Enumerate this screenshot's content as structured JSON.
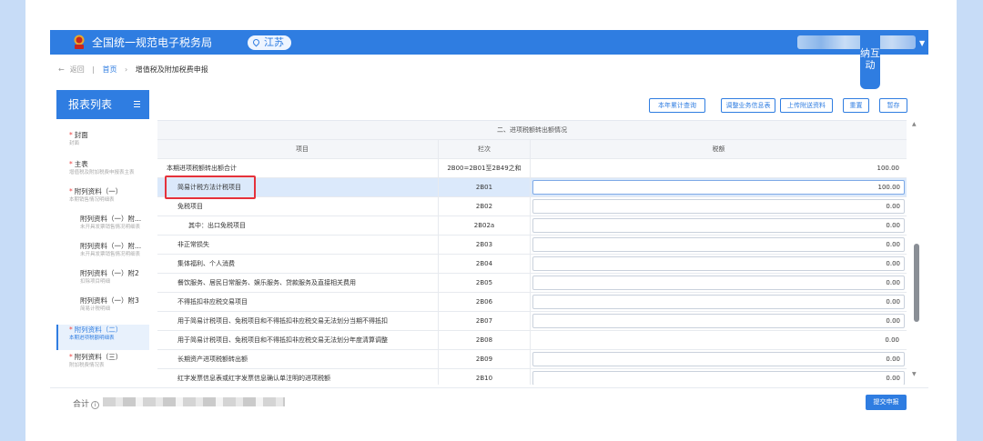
{
  "header": {
    "app_title": "全国统一规范电子税务局",
    "region": "江苏",
    "interact_label": "纳互动"
  },
  "nav": {
    "back": "返回",
    "crumb_home": "首页",
    "crumb_sep": "›",
    "crumb_current": "增值税及附加税费申报"
  },
  "sidebar": {
    "title": "报表列表",
    "items": [
      {
        "title": "封面",
        "sub": "封面",
        "required": true,
        "active": false,
        "indent": false
      },
      {
        "title": "主表",
        "sub": "增值税及附加税费申报表主表",
        "required": true,
        "active": false,
        "indent": false
      },
      {
        "title": "附列资料（一）",
        "sub": "本期销售情况明细表",
        "required": true,
        "active": false,
        "indent": false
      },
      {
        "title": "附列资料（一）附...",
        "sub": "未开具发票销售情况明细表",
        "required": false,
        "active": false,
        "indent": true
      },
      {
        "title": "附列资料（一）附...",
        "sub": "未开具发票销售情况明细表",
        "required": false,
        "active": false,
        "indent": true
      },
      {
        "title": "附列资料（一）附2",
        "sub": "扣除项目明细",
        "required": false,
        "active": false,
        "indent": true
      },
      {
        "title": "附列资料（一）附3",
        "sub": "简易计税明细",
        "required": false,
        "active": false,
        "indent": true
      },
      {
        "title": "附列资料（二）",
        "sub": "本期进项税额明细表",
        "required": true,
        "active": true,
        "indent": false
      },
      {
        "title": "附列资料（三）",
        "sub": "附加税费情况表",
        "required": true,
        "active": false,
        "indent": false
      }
    ]
  },
  "toolbar": {
    "buttons": [
      "本年累计查询",
      "调整业务信息表",
      "上传附送资料",
      "重置",
      "暂存"
    ]
  },
  "table": {
    "section_title": "二、进项税额转出额情况",
    "columns": [
      "项目",
      "栏次",
      "税额"
    ],
    "rows": [
      {
        "item": "本期进项税额转出额合计",
        "code": "2B00=2B01至2B49之和",
        "amount": "100.00",
        "editable": false,
        "selected": false,
        "indent": 0
      },
      {
        "item": "简易计税方法计税项目",
        "code": "2B01",
        "amount": "100.00",
        "editable": true,
        "selected": true,
        "indent": 1
      },
      {
        "item": "免税项目",
        "code": "2B02",
        "amount": "0.00",
        "editable": true,
        "selected": false,
        "indent": 1
      },
      {
        "item": "其中：出口免税项目",
        "code": "2B02a",
        "amount": "0.00",
        "editable": true,
        "selected": false,
        "indent": 2
      },
      {
        "item": "非正常损失",
        "code": "2B03",
        "amount": "0.00",
        "editable": true,
        "selected": false,
        "indent": 1
      },
      {
        "item": "集体福利、个人消费",
        "code": "2B04",
        "amount": "0.00",
        "editable": true,
        "selected": false,
        "indent": 1
      },
      {
        "item": "餐饮服务、居民日常服务、娱乐服务、贷款服务及直接相关费用",
        "code": "2B05",
        "amount": "0.00",
        "editable": true,
        "selected": false,
        "indent": 1
      },
      {
        "item": "不得抵扣非应税交易项目",
        "code": "2B06",
        "amount": "0.00",
        "editable": true,
        "selected": false,
        "indent": 1
      },
      {
        "item": "用于简易计税项目、免税项目和不得抵扣非应税交易无法划分当期不得抵扣",
        "code": "2B07",
        "amount": "0.00",
        "editable": true,
        "selected": false,
        "indent": 1
      },
      {
        "item": "用于简易计税项目、免税项目和不得抵扣非应税交易无法划分年度清算调整",
        "code": "2B08",
        "amount": "0.00",
        "editable": false,
        "selected": false,
        "indent": 1
      },
      {
        "item": "长期资产进项税额转出额",
        "code": "2B09",
        "amount": "0.00",
        "editable": true,
        "selected": false,
        "indent": 1
      },
      {
        "item": "红字发票信息表或红字发票信息确认单注明的进项税额",
        "code": "2B10",
        "amount": "0.00",
        "editable": true,
        "selected": false,
        "indent": 1
      }
    ]
  },
  "footer": {
    "total_label": "合计",
    "submit_label": "提交申报"
  },
  "colors": {
    "primary": "#2f7de1",
    "highlight_border": "#e5313b",
    "selected_row": "#dbe9fb"
  }
}
